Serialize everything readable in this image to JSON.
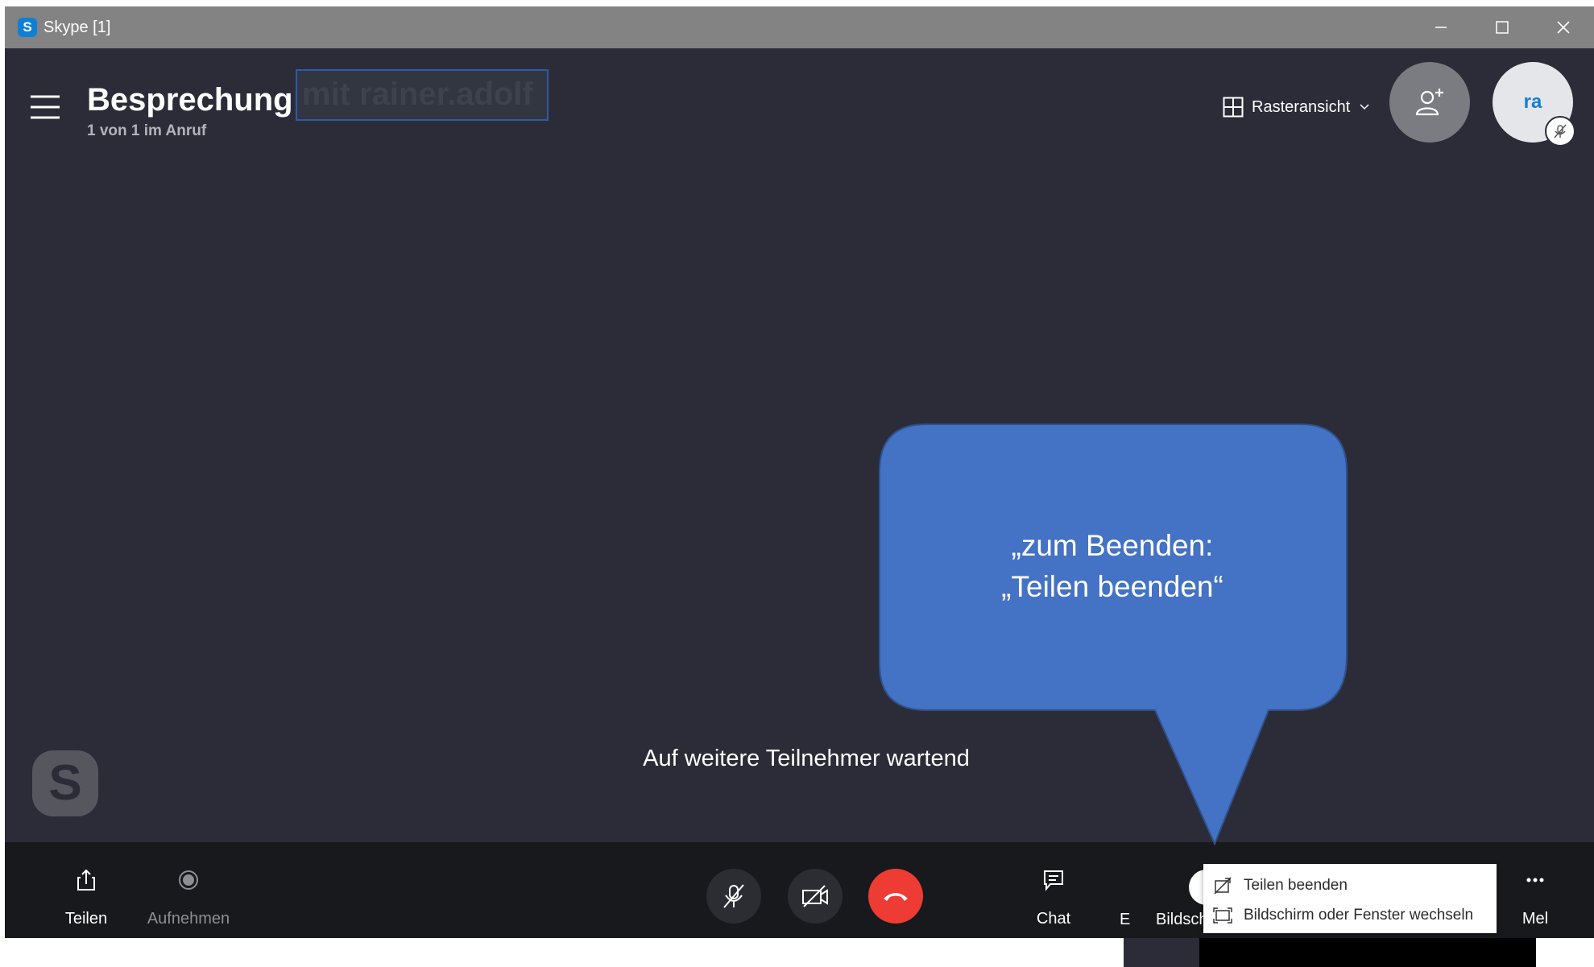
{
  "window": {
    "title": "Skype [1]",
    "app_icon_letter": "S"
  },
  "header": {
    "meeting_title": "Besprechung",
    "meeting_title_suffix": "mit rainer.adolf",
    "participant_count": "1 von 1 im Anruf",
    "view_selector_label": "Rasteransicht",
    "avatar_initials": "ra"
  },
  "main": {
    "waiting_text": "Auf weitere Teilnehmer wartend",
    "watermark_letter": "S"
  },
  "callout": {
    "line1": "„zum Beenden:",
    "line2": "„Teilen beenden“",
    "fill_color": "#4472c4",
    "border_color": "#2f528f"
  },
  "toolbar": {
    "share_label": "Teilen",
    "record_label": "Aufnehmen",
    "chat_label": "Chat",
    "hidden_label_fragment": "E",
    "screen_share_label": "Bildsch",
    "more_label": "Mel",
    "hangup_color": "#ee3b33"
  },
  "share_menu": {
    "items": [
      {
        "label": "Teilen beenden",
        "icon": "stop-sharing-icon"
      },
      {
        "label": "Bildschirm oder Fenster wechseln",
        "icon": "switch-screen-icon"
      }
    ]
  },
  "colors": {
    "background": "#2b2c37",
    "titlebar": "#838383",
    "toolbar": "#18191c",
    "accent": "#0f7fd6"
  }
}
